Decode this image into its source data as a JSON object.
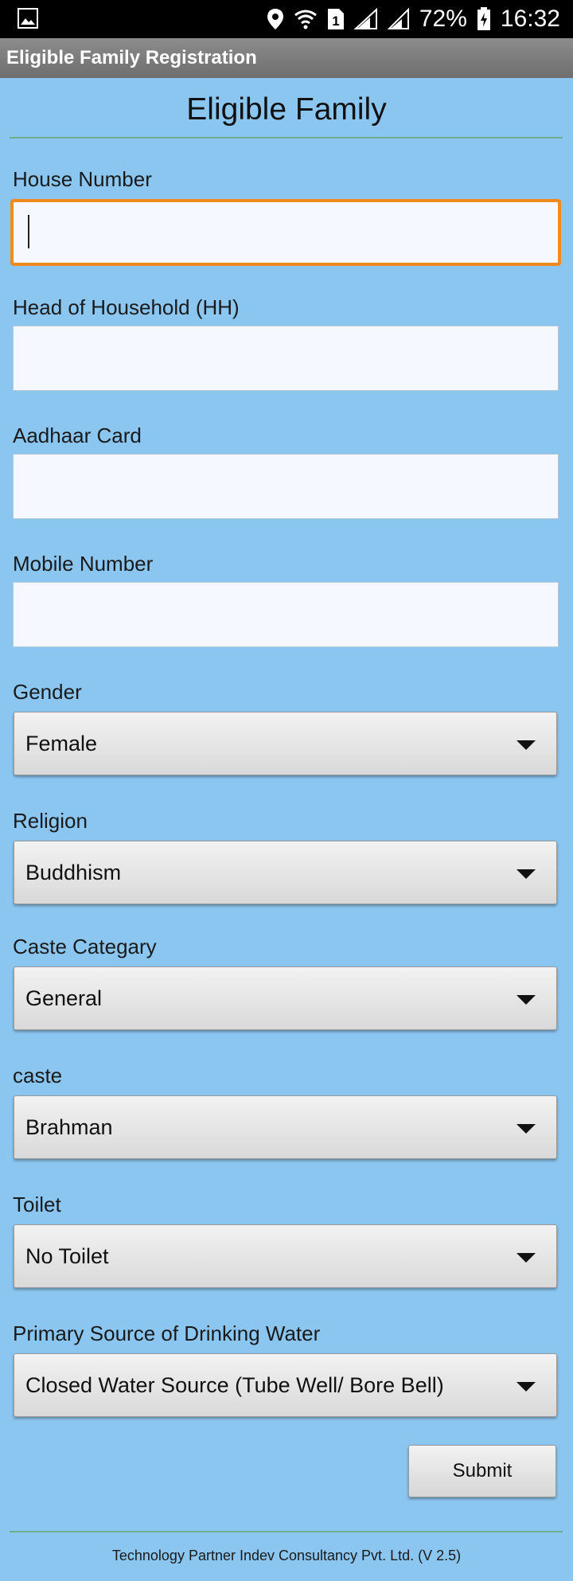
{
  "status_bar": {
    "battery": "72%",
    "time": "16:32",
    "sim_slot": "1",
    "icons": [
      "image-icon",
      "location-icon",
      "wifi-icon",
      "sim-icon",
      "signal-icon",
      "signal-icon",
      "battery-charging-icon"
    ]
  },
  "app_bar": {
    "title": "Eligible Family Registration"
  },
  "form": {
    "heading": "Eligible Family",
    "fields": [
      {
        "label": "House Number",
        "value": ""
      },
      {
        "label": "Head of Household (HH)",
        "value": ""
      },
      {
        "label": "Aadhaar Card",
        "value": ""
      },
      {
        "label": "Mobile Number",
        "value": ""
      }
    ],
    "selects": [
      {
        "label": "Gender",
        "value": "Female"
      },
      {
        "label": "Religion",
        "value": "Buddhism"
      },
      {
        "label": "Caste Categary",
        "value": "General"
      },
      {
        "label": "caste",
        "value": "Brahman"
      },
      {
        "label": "Toilet",
        "value": "No Toilet"
      },
      {
        "label": "Primary Source of Drinking Water",
        "value": "Closed Water Source (Tube Well/ Bore Bell)"
      }
    ],
    "submit_label": "Submit"
  },
  "footer": {
    "text": "Technology Partner Indev Consultancy Pvt. Ltd. (V 2.5)"
  },
  "colors": {
    "background": "#8bc6f1",
    "focus_border": "#f08a1c",
    "divider": "#6fae8a"
  }
}
